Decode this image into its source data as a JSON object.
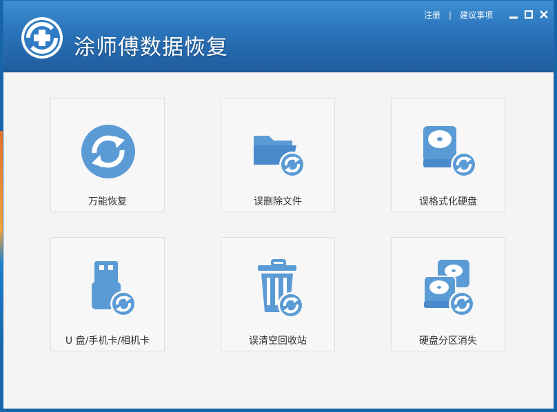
{
  "app": {
    "title": "涂师傅数据恢复"
  },
  "header": {
    "register_label": "注册",
    "separator": "|",
    "suggest_label": "建议事项"
  },
  "accent_color": "#5b9bd5",
  "cards": [
    {
      "label": "万能恢复",
      "icon": "recover-all-icon"
    },
    {
      "label": "误删除文件",
      "icon": "folder-recover-icon"
    },
    {
      "label": "误格式化硬盘",
      "icon": "disk-recover-icon"
    },
    {
      "label": "U 盘/手机卡/相机卡",
      "icon": "usb-recover-icon"
    },
    {
      "label": "误清空回收站",
      "icon": "recycle-bin-recover-icon"
    },
    {
      "label": "硬盘分区消失",
      "icon": "partition-recover-icon"
    }
  ]
}
